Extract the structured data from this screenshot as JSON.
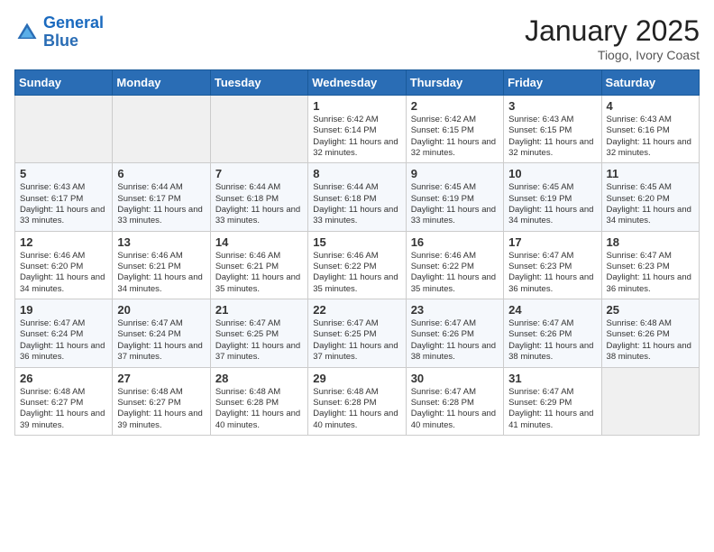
{
  "header": {
    "logo_line1": "General",
    "logo_line2": "Blue",
    "title": "January 2025",
    "subtitle": "Tiogo, Ivory Coast"
  },
  "days_of_week": [
    "Sunday",
    "Monday",
    "Tuesday",
    "Wednesday",
    "Thursday",
    "Friday",
    "Saturday"
  ],
  "weeks": [
    [
      {
        "day": "",
        "info": ""
      },
      {
        "day": "",
        "info": ""
      },
      {
        "day": "",
        "info": ""
      },
      {
        "day": "1",
        "info": "Sunrise: 6:42 AM\nSunset: 6:14 PM\nDaylight: 11 hours and 32 minutes."
      },
      {
        "day": "2",
        "info": "Sunrise: 6:42 AM\nSunset: 6:15 PM\nDaylight: 11 hours and 32 minutes."
      },
      {
        "day": "3",
        "info": "Sunrise: 6:43 AM\nSunset: 6:15 PM\nDaylight: 11 hours and 32 minutes."
      },
      {
        "day": "4",
        "info": "Sunrise: 6:43 AM\nSunset: 6:16 PM\nDaylight: 11 hours and 32 minutes."
      }
    ],
    [
      {
        "day": "5",
        "info": "Sunrise: 6:43 AM\nSunset: 6:17 PM\nDaylight: 11 hours and 33 minutes."
      },
      {
        "day": "6",
        "info": "Sunrise: 6:44 AM\nSunset: 6:17 PM\nDaylight: 11 hours and 33 minutes."
      },
      {
        "day": "7",
        "info": "Sunrise: 6:44 AM\nSunset: 6:18 PM\nDaylight: 11 hours and 33 minutes."
      },
      {
        "day": "8",
        "info": "Sunrise: 6:44 AM\nSunset: 6:18 PM\nDaylight: 11 hours and 33 minutes."
      },
      {
        "day": "9",
        "info": "Sunrise: 6:45 AM\nSunset: 6:19 PM\nDaylight: 11 hours and 33 minutes."
      },
      {
        "day": "10",
        "info": "Sunrise: 6:45 AM\nSunset: 6:19 PM\nDaylight: 11 hours and 34 minutes."
      },
      {
        "day": "11",
        "info": "Sunrise: 6:45 AM\nSunset: 6:20 PM\nDaylight: 11 hours and 34 minutes."
      }
    ],
    [
      {
        "day": "12",
        "info": "Sunrise: 6:46 AM\nSunset: 6:20 PM\nDaylight: 11 hours and 34 minutes."
      },
      {
        "day": "13",
        "info": "Sunrise: 6:46 AM\nSunset: 6:21 PM\nDaylight: 11 hours and 34 minutes."
      },
      {
        "day": "14",
        "info": "Sunrise: 6:46 AM\nSunset: 6:21 PM\nDaylight: 11 hours and 35 minutes."
      },
      {
        "day": "15",
        "info": "Sunrise: 6:46 AM\nSunset: 6:22 PM\nDaylight: 11 hours and 35 minutes."
      },
      {
        "day": "16",
        "info": "Sunrise: 6:46 AM\nSunset: 6:22 PM\nDaylight: 11 hours and 35 minutes."
      },
      {
        "day": "17",
        "info": "Sunrise: 6:47 AM\nSunset: 6:23 PM\nDaylight: 11 hours and 36 minutes."
      },
      {
        "day": "18",
        "info": "Sunrise: 6:47 AM\nSunset: 6:23 PM\nDaylight: 11 hours and 36 minutes."
      }
    ],
    [
      {
        "day": "19",
        "info": "Sunrise: 6:47 AM\nSunset: 6:24 PM\nDaylight: 11 hours and 36 minutes."
      },
      {
        "day": "20",
        "info": "Sunrise: 6:47 AM\nSunset: 6:24 PM\nDaylight: 11 hours and 37 minutes."
      },
      {
        "day": "21",
        "info": "Sunrise: 6:47 AM\nSunset: 6:25 PM\nDaylight: 11 hours and 37 minutes."
      },
      {
        "day": "22",
        "info": "Sunrise: 6:47 AM\nSunset: 6:25 PM\nDaylight: 11 hours and 37 minutes."
      },
      {
        "day": "23",
        "info": "Sunrise: 6:47 AM\nSunset: 6:26 PM\nDaylight: 11 hours and 38 minutes."
      },
      {
        "day": "24",
        "info": "Sunrise: 6:47 AM\nSunset: 6:26 PM\nDaylight: 11 hours and 38 minutes."
      },
      {
        "day": "25",
        "info": "Sunrise: 6:48 AM\nSunset: 6:26 PM\nDaylight: 11 hours and 38 minutes."
      }
    ],
    [
      {
        "day": "26",
        "info": "Sunrise: 6:48 AM\nSunset: 6:27 PM\nDaylight: 11 hours and 39 minutes."
      },
      {
        "day": "27",
        "info": "Sunrise: 6:48 AM\nSunset: 6:27 PM\nDaylight: 11 hours and 39 minutes."
      },
      {
        "day": "28",
        "info": "Sunrise: 6:48 AM\nSunset: 6:28 PM\nDaylight: 11 hours and 40 minutes."
      },
      {
        "day": "29",
        "info": "Sunrise: 6:48 AM\nSunset: 6:28 PM\nDaylight: 11 hours and 40 minutes."
      },
      {
        "day": "30",
        "info": "Sunrise: 6:47 AM\nSunset: 6:28 PM\nDaylight: 11 hours and 40 minutes."
      },
      {
        "day": "31",
        "info": "Sunrise: 6:47 AM\nSunset: 6:29 PM\nDaylight: 11 hours and 41 minutes."
      },
      {
        "day": "",
        "info": ""
      }
    ]
  ]
}
